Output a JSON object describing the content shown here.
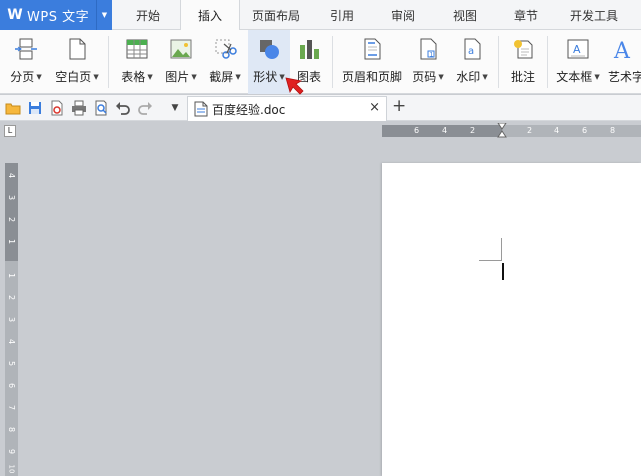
{
  "app": {
    "logo": "W",
    "name": "WPS 文字",
    "caret": "▼"
  },
  "menu_tabs": [
    "开始",
    "插入",
    "页面布局",
    "引用",
    "审阅",
    "视图",
    "章节",
    "开发工具"
  ],
  "active_tab": "插入",
  "ribbon": {
    "page_break": "分页",
    "blank_page": "空白页",
    "table": "表格",
    "picture": "图片",
    "screenshot": "截屏",
    "shape": "形状",
    "chart": "图表",
    "header_footer": "页眉和页脚",
    "page_number": "页码",
    "watermark": "水印",
    "comment": "批注",
    "text_box": "文本框",
    "art_text": "艺术字"
  },
  "document_tab": {
    "name": "百度经验.doc",
    "close": "×"
  },
  "add_tab": "+",
  "hruler_numbers": [
    "6",
    "4",
    "2",
    "2",
    "4",
    "6",
    "8"
  ],
  "vruler_numbers": [
    "4",
    "3",
    "2",
    "1",
    "1",
    "2",
    "3",
    "4",
    "5",
    "6",
    "7",
    "8",
    "9",
    "10"
  ],
  "ruler_corner": "L",
  "colors": {
    "accent": "#3b7ddd",
    "pointer": "#e02020"
  }
}
